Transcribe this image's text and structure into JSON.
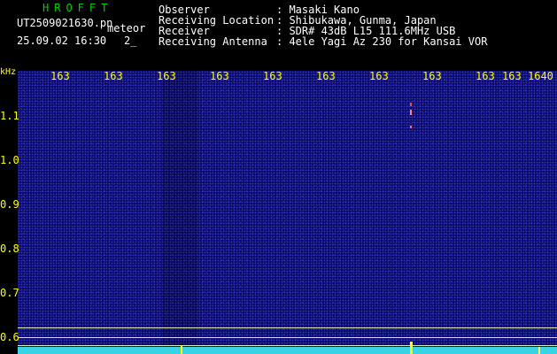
{
  "header": {
    "logo": "HROFFT",
    "filename": "UT2509021630.pn",
    "filename_suffix": "meteor",
    "datetime": "25.09.02 16:30",
    "index": "2_"
  },
  "info": {
    "observer_label": "Observer",
    "observer_value": ": Masaki Kano",
    "location_label": "Receiving Location",
    "location_value": ": Shibukawa, Gunma, Japan",
    "receiver_label": "Receiver",
    "receiver_value": ": SDR# 43dB L15 111.6MHz USB",
    "antenna_label": "Receiving Antenna",
    "antenna_value": ": 4ele Yagi Az 230 for Kansai VOR"
  },
  "axis": {
    "y_unit": "kHz",
    "x_ticks": [
      "163",
      "163",
      "163",
      "163",
      "163",
      "163",
      "163",
      "163",
      "163",
      "163",
      "1640"
    ],
    "y_ticks": [
      "1.1",
      "1.0",
      "0.9",
      "0.8",
      "0.7",
      "0.6"
    ]
  },
  "colors": {
    "tick_text": "#ffff00",
    "logo": "#00d000",
    "background": "#000000",
    "plot_bg": "#0a0a64",
    "bottom_band": "#39d3e6"
  }
}
